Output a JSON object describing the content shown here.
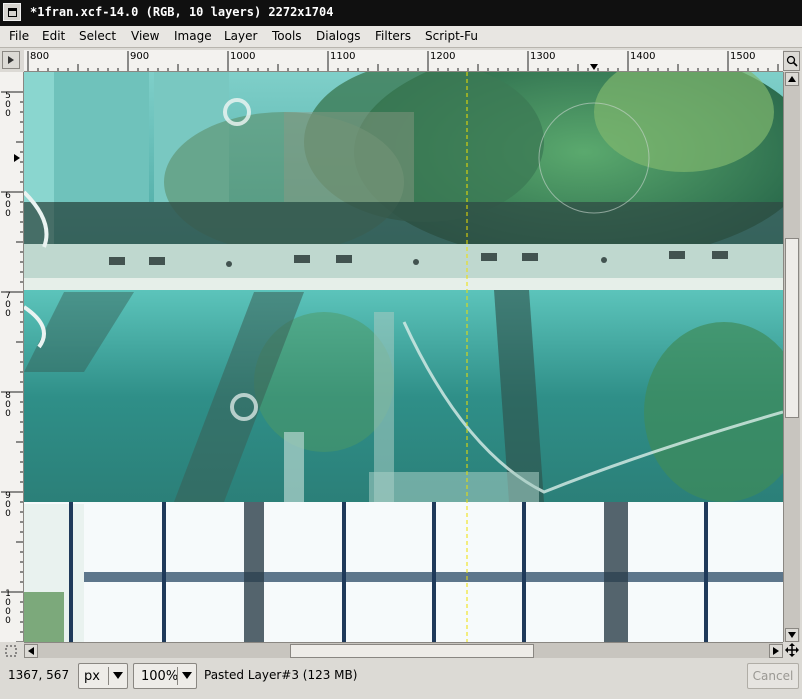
{
  "window": {
    "title": "*1fran.xcf-14.0 (RGB, 10 layers) 2272x1704"
  },
  "menubar": {
    "items": [
      {
        "label": "File",
        "mnemonic": "F"
      },
      {
        "label": "Edit",
        "mnemonic": "E"
      },
      {
        "label": "Select",
        "mnemonic": "S"
      },
      {
        "label": "View",
        "mnemonic": "V"
      },
      {
        "label": "Image",
        "mnemonic": "I"
      },
      {
        "label": "Layer",
        "mnemonic": "L"
      },
      {
        "label": "Tools",
        "mnemonic": "T"
      },
      {
        "label": "Dialogs",
        "mnemonic": "D"
      },
      {
        "label": "Filters",
        "mnemonic": "r"
      },
      {
        "label": "Script-Fu",
        "mnemonic": "c"
      }
    ]
  },
  "rulers": {
    "horizontal_labels": [
      "800",
      "900",
      "1000",
      "1100",
      "1200",
      "1300",
      "1400",
      "1500"
    ],
    "vertical_labels": [
      "500",
      "600",
      "700",
      "800",
      "900",
      "1000"
    ]
  },
  "canvas": {
    "description_icon": "image-canvas"
  },
  "statusbar": {
    "pointer_coords": "1367, 567",
    "unit": "px",
    "zoom": "100%",
    "layer_info": "Pasted Layer#3 (123 MB)",
    "cancel_label": "Cancel"
  },
  "colors": {
    "titlebar": "#101010",
    "guide": "#f0e000",
    "canvas_teal": "#3aa8a0"
  }
}
